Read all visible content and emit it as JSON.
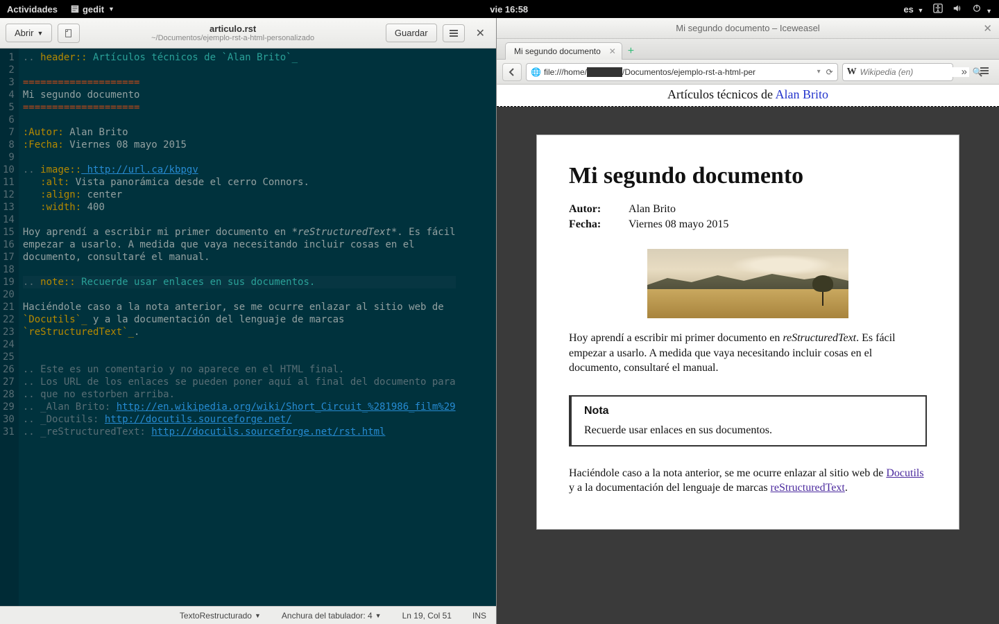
{
  "topbar": {
    "activities": "Actividades",
    "app": "gedit",
    "clock": "vie 16:58",
    "lang": "es"
  },
  "gedit": {
    "open": "Abrir",
    "save": "Guardar",
    "title": "articulo.rst",
    "path": "~/Documentos/ejemplo-rst-a-html-personalizado",
    "status": {
      "syntax": "TextoRestructurado",
      "tab": "Anchura del tabulador: 4",
      "pos": "Ln 19, Col 51",
      "mode": "INS"
    },
    "lines": [
      {
        "n": 1,
        "a": ".. ",
        "b": "header::",
        "c": " Artículos técnicos de `Alan Brito`_"
      },
      {
        "n": 2,
        "raw": ""
      },
      {
        "n": 3,
        "orange": "===================="
      },
      {
        "n": 4,
        "plain": "Mi segundo documento"
      },
      {
        "n": 5,
        "orange": "===================="
      },
      {
        "n": 6,
        "raw": ""
      },
      {
        "n": 7,
        "field": ":Autor:",
        "val": " Alan Brito"
      },
      {
        "n": 8,
        "field": ":Fecha:",
        "val": " Viernes 08 mayo 2015"
      },
      {
        "n": 9,
        "raw": ""
      },
      {
        "n": 10,
        "a": ".. ",
        "b": "image::",
        "url": " http://url.ca/kbpgv"
      },
      {
        "n": 11,
        "opt": "   :alt:",
        "val": " Vista panorámica desde el cerro Connors."
      },
      {
        "n": 12,
        "opt": "   :align:",
        "val": " center"
      },
      {
        "n": 13,
        "opt": "   :width:",
        "val": " 400"
      },
      {
        "n": 14,
        "raw": ""
      },
      {
        "n": 15,
        "para": "Hoy aprendí a escribir mi primer documento en *",
        "ital": "reStructuredText",
        "rest": "*. Es fácil"
      },
      {
        "n": 16,
        "plain": "empezar a usarlo. A medida que vaya necesitando incluir cosas en el"
      },
      {
        "n": 17,
        "plain": "documento, consultaré el manual."
      },
      {
        "n": 18,
        "raw": ""
      },
      {
        "n": 19,
        "hl": true,
        "a": ".. ",
        "b": "note::",
        "c": " Recuerde usar enlaces en sus documentos."
      },
      {
        "n": 20,
        "raw": ""
      },
      {
        "n": 21,
        "plain": "Haciéndole caso a la nota anterior, se me ocurre enlazar al sitio web de"
      },
      {
        "n": 22,
        "link1": "`Docutils`_",
        "mid": " y a la documentación del lenguaje de marcas"
      },
      {
        "n": 23,
        "link1": "`reStructuredText`_",
        "mid": "."
      },
      {
        "n": 24,
        "raw": ""
      },
      {
        "n": 25,
        "raw": ""
      },
      {
        "n": 26,
        "comment": ".. Este es un comentario y no aparece en el HTML final."
      },
      {
        "n": 27,
        "comment": ".. Los URL de los enlaces se pueden poner aquí al final del documento para"
      },
      {
        "n": 28,
        "comment": ".. que no estorben arriba."
      },
      {
        "n": 29,
        "target": ".. _Alan Brito: ",
        "url": "http://en.wikipedia.org/wiki/Short_Circuit_%281986_film%29"
      },
      {
        "n": 30,
        "target": ".. _Docutils: ",
        "url": "http://docutils.sourceforge.net/"
      },
      {
        "n": 31,
        "target": ".. _reStructuredText: ",
        "url": "http://docutils.sourceforge.net/rst.html"
      }
    ]
  },
  "browser": {
    "window_title": "Mi segundo documento – Iceweasel",
    "tab": "Mi segundo documento",
    "url": "file:///home/██████/Documentos/ejemplo-rst-a-html-per",
    "search_placeholder": "Wikipedia (en)",
    "header_text": "Artículos técnicos de ",
    "header_link": "Alan Brito",
    "h1": "Mi segundo documento",
    "autor_label": "Autor:",
    "autor_value": "Alan Brito",
    "fecha_label": "Fecha:",
    "fecha_value": "Viernes 08 mayo 2015",
    "p1_a": "Hoy aprendí a escribir mi primer documento en ",
    "p1_em": "reStructuredText",
    "p1_b": ". Es fácil empezar a usarlo. A medida que vaya necesitando incluir cosas en el documento, consultaré el manual.",
    "note_title": "Nota",
    "note_body": "Recuerde usar enlaces en sus documentos.",
    "p2_a": "Haciéndole caso a la nota anterior, se me ocurre enlazar al sitio web de ",
    "p2_link1": "Docutils",
    "p2_b": " y a la documentación del lenguaje de marcas ",
    "p2_link2": "reStructuredText",
    "p2_c": "."
  }
}
